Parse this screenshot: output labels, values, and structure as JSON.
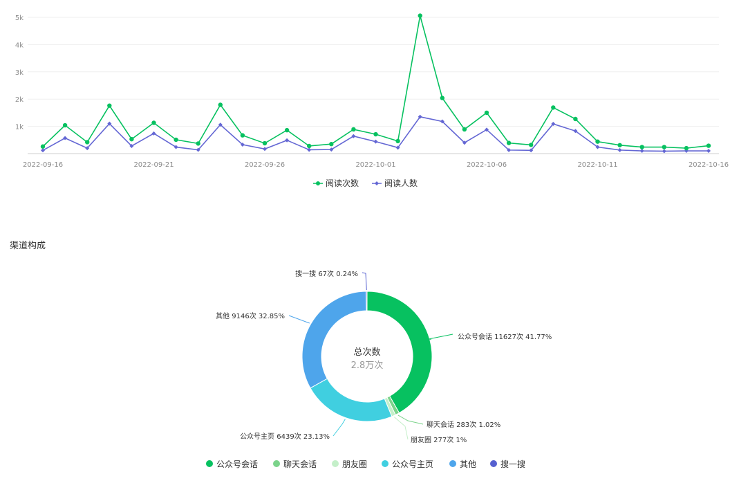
{
  "chart_data": [
    {
      "type": "line",
      "x": [
        "2022-09-16",
        "2022-09-17",
        "2022-09-18",
        "2022-09-19",
        "2022-09-20",
        "2022-09-21",
        "2022-09-22",
        "2022-09-23",
        "2022-09-24",
        "2022-09-25",
        "2022-09-26",
        "2022-09-27",
        "2022-09-28",
        "2022-09-29",
        "2022-09-30",
        "2022-10-01",
        "2022-10-02",
        "2022-10-03",
        "2022-10-04",
        "2022-10-05",
        "2022-10-06",
        "2022-10-07",
        "2022-10-08",
        "2022-10-09",
        "2022-10-10",
        "2022-10-11",
        "2022-10-12",
        "2022-10-13",
        "2022-10-14",
        "2022-10-15",
        "2022-10-16"
      ],
      "x_ticks": [
        "2022-09-16",
        "2022-09-21",
        "2022-09-26",
        "2022-10-01",
        "2022-10-06",
        "2022-10-11",
        "2022-10-16"
      ],
      "y_ticks": [
        "1k",
        "2k",
        "3k",
        "4k",
        "5k"
      ],
      "ylim": [
        0,
        5000
      ],
      "grid": true,
      "legend_position": "bottom-center",
      "series": [
        {
          "name": "阅读次数",
          "color": "#07c160",
          "marker": "circle",
          "values": [
            260,
            1040,
            420,
            1760,
            530,
            1130,
            510,
            370,
            1790,
            670,
            380,
            860,
            280,
            350,
            890,
            710,
            460,
            5060,
            2040,
            890,
            1500,
            390,
            320,
            1690,
            1270,
            440,
            310,
            240,
            240,
            200,
            290
          ]
        },
        {
          "name": "阅读人数",
          "color": "#6467d4",
          "marker": "diamond",
          "values": [
            120,
            570,
            200,
            1100,
            280,
            740,
            240,
            140,
            1060,
            330,
            170,
            490,
            140,
            150,
            640,
            440,
            220,
            1350,
            1180,
            400,
            880,
            130,
            120,
            1090,
            830,
            240,
            130,
            100,
            90,
            100,
            100
          ]
        }
      ]
    },
    {
      "type": "pie",
      "center_title": "总次数",
      "center_value": "2.8万次",
      "legend_position": "bottom-center",
      "slices": [
        {
          "name": "公众号会话",
          "value": 11627,
          "percent": 41.77,
          "label": "公众号会话 11627次 41.77%",
          "color": "#07c160"
        },
        {
          "name": "聊天会话",
          "value": 283,
          "percent": 1.02,
          "label": "聊天会话 283次 1.02%",
          "color": "#7bd38a"
        },
        {
          "name": "朋友圈",
          "value": 277,
          "percent": 1.0,
          "label": "朋友圈 277次 1%",
          "color": "#c4efc9"
        },
        {
          "name": "公众号主页",
          "value": 6439,
          "percent": 23.13,
          "label": "公众号主页 6439次 23.13%",
          "color": "#40cfe0"
        },
        {
          "name": "其他",
          "value": 9146,
          "percent": 32.85,
          "label": "其他 9146次 32.85%",
          "color": "#4ea5eb"
        },
        {
          "name": "搜一搜",
          "value": 67,
          "percent": 0.24,
          "label": "搜一搜 67次 0.24%",
          "color": "#5560d0"
        }
      ]
    }
  ],
  "section": {
    "title": "渠道构成"
  }
}
